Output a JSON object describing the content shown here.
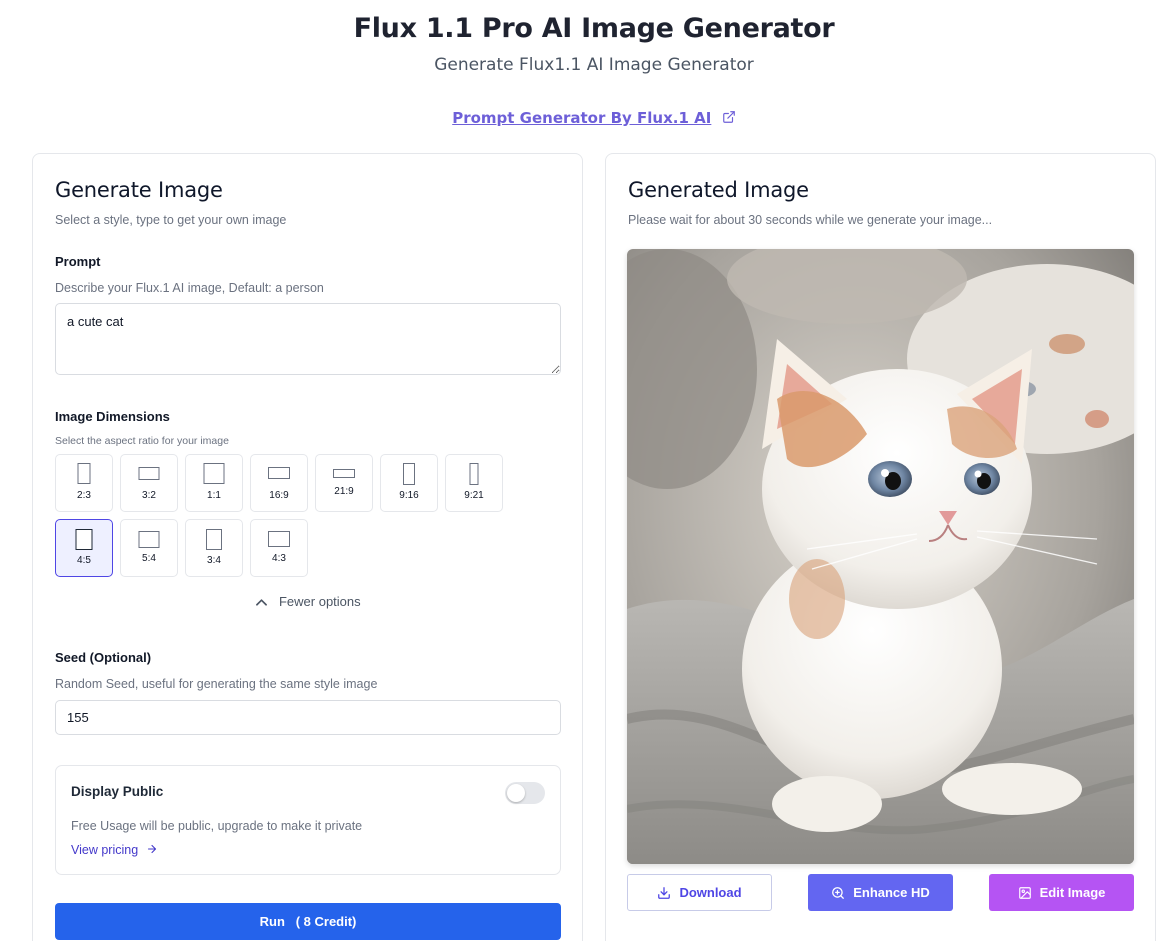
{
  "header": {
    "title": "Flux 1.1 Pro AI Image Generator",
    "subtitle": "Generate Flux1.1 AI Image Generator",
    "prompt_link": "Prompt Generator By Flux.1 AI"
  },
  "left_panel": {
    "title": "Generate Image",
    "description": "Select a style, type to get your own image",
    "prompt": {
      "label": "Prompt",
      "help": "Describe your Flux.1 AI image, Default: a person",
      "value": "a cute cat"
    },
    "dimensions": {
      "label": "Image Dimensions",
      "help": "Select the aspect ratio for your image",
      "ratios": [
        "2:3",
        "3:2",
        "1:1",
        "16:9",
        "21:9",
        "9:16",
        "9:21",
        "4:5",
        "5:4",
        "3:4",
        "4:3"
      ],
      "selected": "4:5",
      "toggle_label": "Fewer options"
    },
    "seed": {
      "label": "Seed (Optional)",
      "help": "Random Seed, useful for generating the same style image",
      "value": "155"
    },
    "display_public": {
      "title": "Display Public",
      "enabled": false,
      "description": "Free Usage will be public, upgrade to make it private",
      "pricing_link": "View pricing"
    },
    "run_button": "Run   ( 8 Credit)"
  },
  "right_panel": {
    "title": "Generated Image",
    "description": "Please wait for about 30 seconds while we generate your image...",
    "buttons": {
      "download": "Download",
      "enhance": "Enhance HD",
      "edit": "Edit Image"
    }
  },
  "colors": {
    "primary_blue": "#2563eb",
    "indigo": "#6366f1",
    "purple": "#b554f3",
    "link": "#6d5fd8"
  },
  "icons": [
    "external-link-icon",
    "chevron-up-icon",
    "arrow-right-icon",
    "download-icon",
    "zoom-in-icon",
    "edit-image-icon"
  ]
}
